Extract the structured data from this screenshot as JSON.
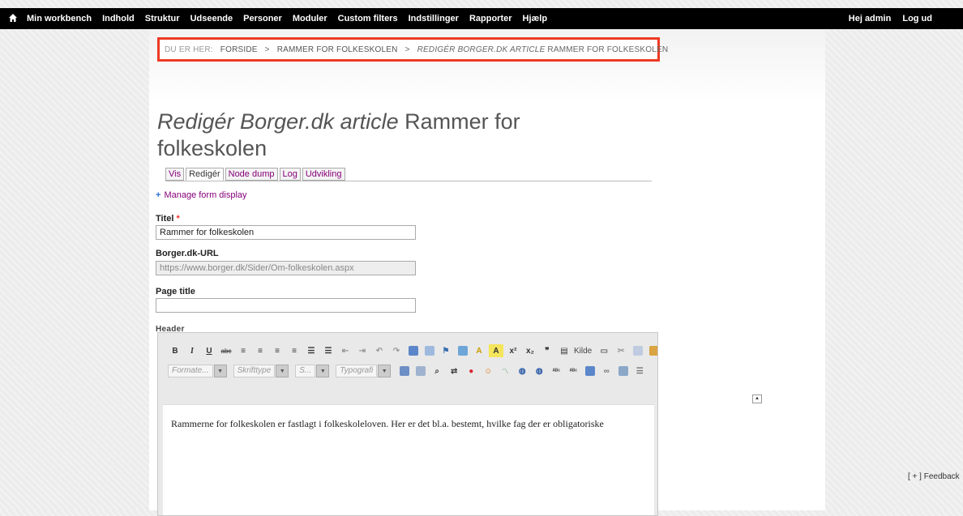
{
  "toolbar": {
    "menu": [
      "Min workbench",
      "Indhold",
      "Struktur",
      "Udseende",
      "Personer",
      "Moduler",
      "Custom filters",
      "Indstillinger",
      "Rapporter",
      "Hjælp"
    ],
    "greeting": "Hej admin",
    "logout": "Log ud"
  },
  "breadcrumb": {
    "label": "DU ER HER:",
    "sep": ">",
    "home": "FORSIDE",
    "parent": "RAMMER FOR FOLKESKOLEN",
    "current_em": "REDIGÉR BORGER.DK ARTICLE",
    "current_rest": "RAMMER FOR FOLKESKOLEN"
  },
  "title": {
    "em": "Redigér Borger.dk article",
    "rest": "Rammer for folkeskolen"
  },
  "tabs": [
    "Vis",
    "Redigér",
    "Node dump",
    "Log",
    "Udvikling"
  ],
  "manage_link": "Manage form display",
  "form": {
    "titel_label": "Titel",
    "required_mark": "*",
    "titel_value": "Rammer for folkeskolen",
    "url_label": "Borger.dk-URL",
    "url_value": "https://www.borger.dk/Sider/Om-folkeskolen.aspx",
    "page_title_label": "Page title",
    "page_title_value": "",
    "header_label": "Header"
  },
  "editor": {
    "row1": [
      "B",
      "I",
      "U",
      "abc"
    ],
    "source_label": "Kilde",
    "combos": [
      "Formate...",
      "Skrifttype",
      "S...",
      "Typografi"
    ],
    "content": "Rammerne for folkeskolen er fastlagt i folkeskoleloven. Her er det bl.a. bestemt, hvilke fag der er obligatoriske"
  },
  "feedback": "[ + ] Feedback",
  "colors": {
    "breadcrumb_border": "#ee3a24",
    "link": "#86007a",
    "toolbar_bg": "#000000"
  }
}
